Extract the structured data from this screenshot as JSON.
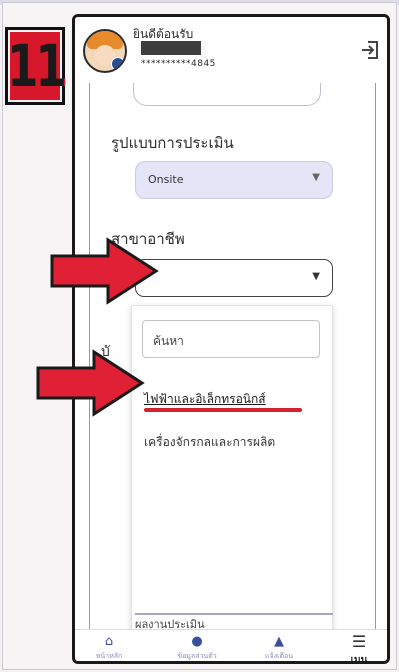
{
  "step": {
    "number": "11"
  },
  "header": {
    "greeting": "ยินดีต้อนรับ",
    "phone_masked": "**********4845"
  },
  "form": {
    "assessment_label": "รูปแบบการประเมิน",
    "assessment_value": "Onsite",
    "occupation_label": "สาขาอาชีพ",
    "occupation_value": "",
    "hidden_label": "บั",
    "bottom_peek": "ผลงานประเมิน"
  },
  "dropdown": {
    "search_placeholder": "ค้นหา",
    "options": [
      "ไฟฟ้าและอิเล็กทรอนิกส์",
      "เครื่องจักรกลและการผลิต"
    ]
  },
  "nav": {
    "items": [
      {
        "icon": "home-icon",
        "label": "หน้าหลัก"
      },
      {
        "icon": "user-icon",
        "label": "ข้อมูลส่วนตัว"
      },
      {
        "icon": "bell-icon",
        "label": "แจ้งเตือน"
      },
      {
        "icon": "menu-icon",
        "label": "เมนู"
      }
    ]
  },
  "colors": {
    "accent": "#d7182a",
    "arrow": "#e02034",
    "primary": "#3a4fa0"
  }
}
